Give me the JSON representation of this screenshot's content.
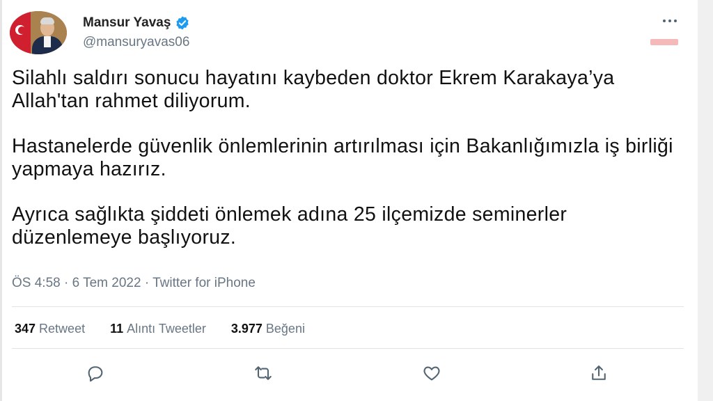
{
  "author": {
    "name": "Mansur Yavaş",
    "handle": "@mansuryavas06"
  },
  "tweet": {
    "paragraphs": [
      "Silahlı saldırı sonucu hayatını kaybeden doktor Ekrem Karakaya’ya Allah'tan rahmet diliyorum.",
      "Hastanelerde güvenlik önlemlerinin artırılması için Bakanlığımızla iş birliği yapmaya hazırız.",
      "Ayrıca sağlıkta şiddeti önlemek adına 25 ilçemizde seminerler düzenlemeye başlıyoruz."
    ],
    "meta": "ÖS 4:58 · 6 Tem 2022 · Twitter for iPhone"
  },
  "stats": {
    "retweets_count": "347",
    "retweets_label": "Retweet",
    "quotes_count": "11",
    "quotes_label": "Alıntı Tweetler",
    "likes_count": "3.977",
    "likes_label": "Beğeni"
  },
  "icons": {
    "verified": "verified-badge-icon",
    "reply": "reply-icon",
    "retweet": "retweet-icon",
    "like": "heart-icon",
    "share": "share-icon",
    "more": "more-icon"
  },
  "colors": {
    "verified": "#1d9bf0",
    "secondary_text": "#687684",
    "primary_text": "#0f1419"
  }
}
